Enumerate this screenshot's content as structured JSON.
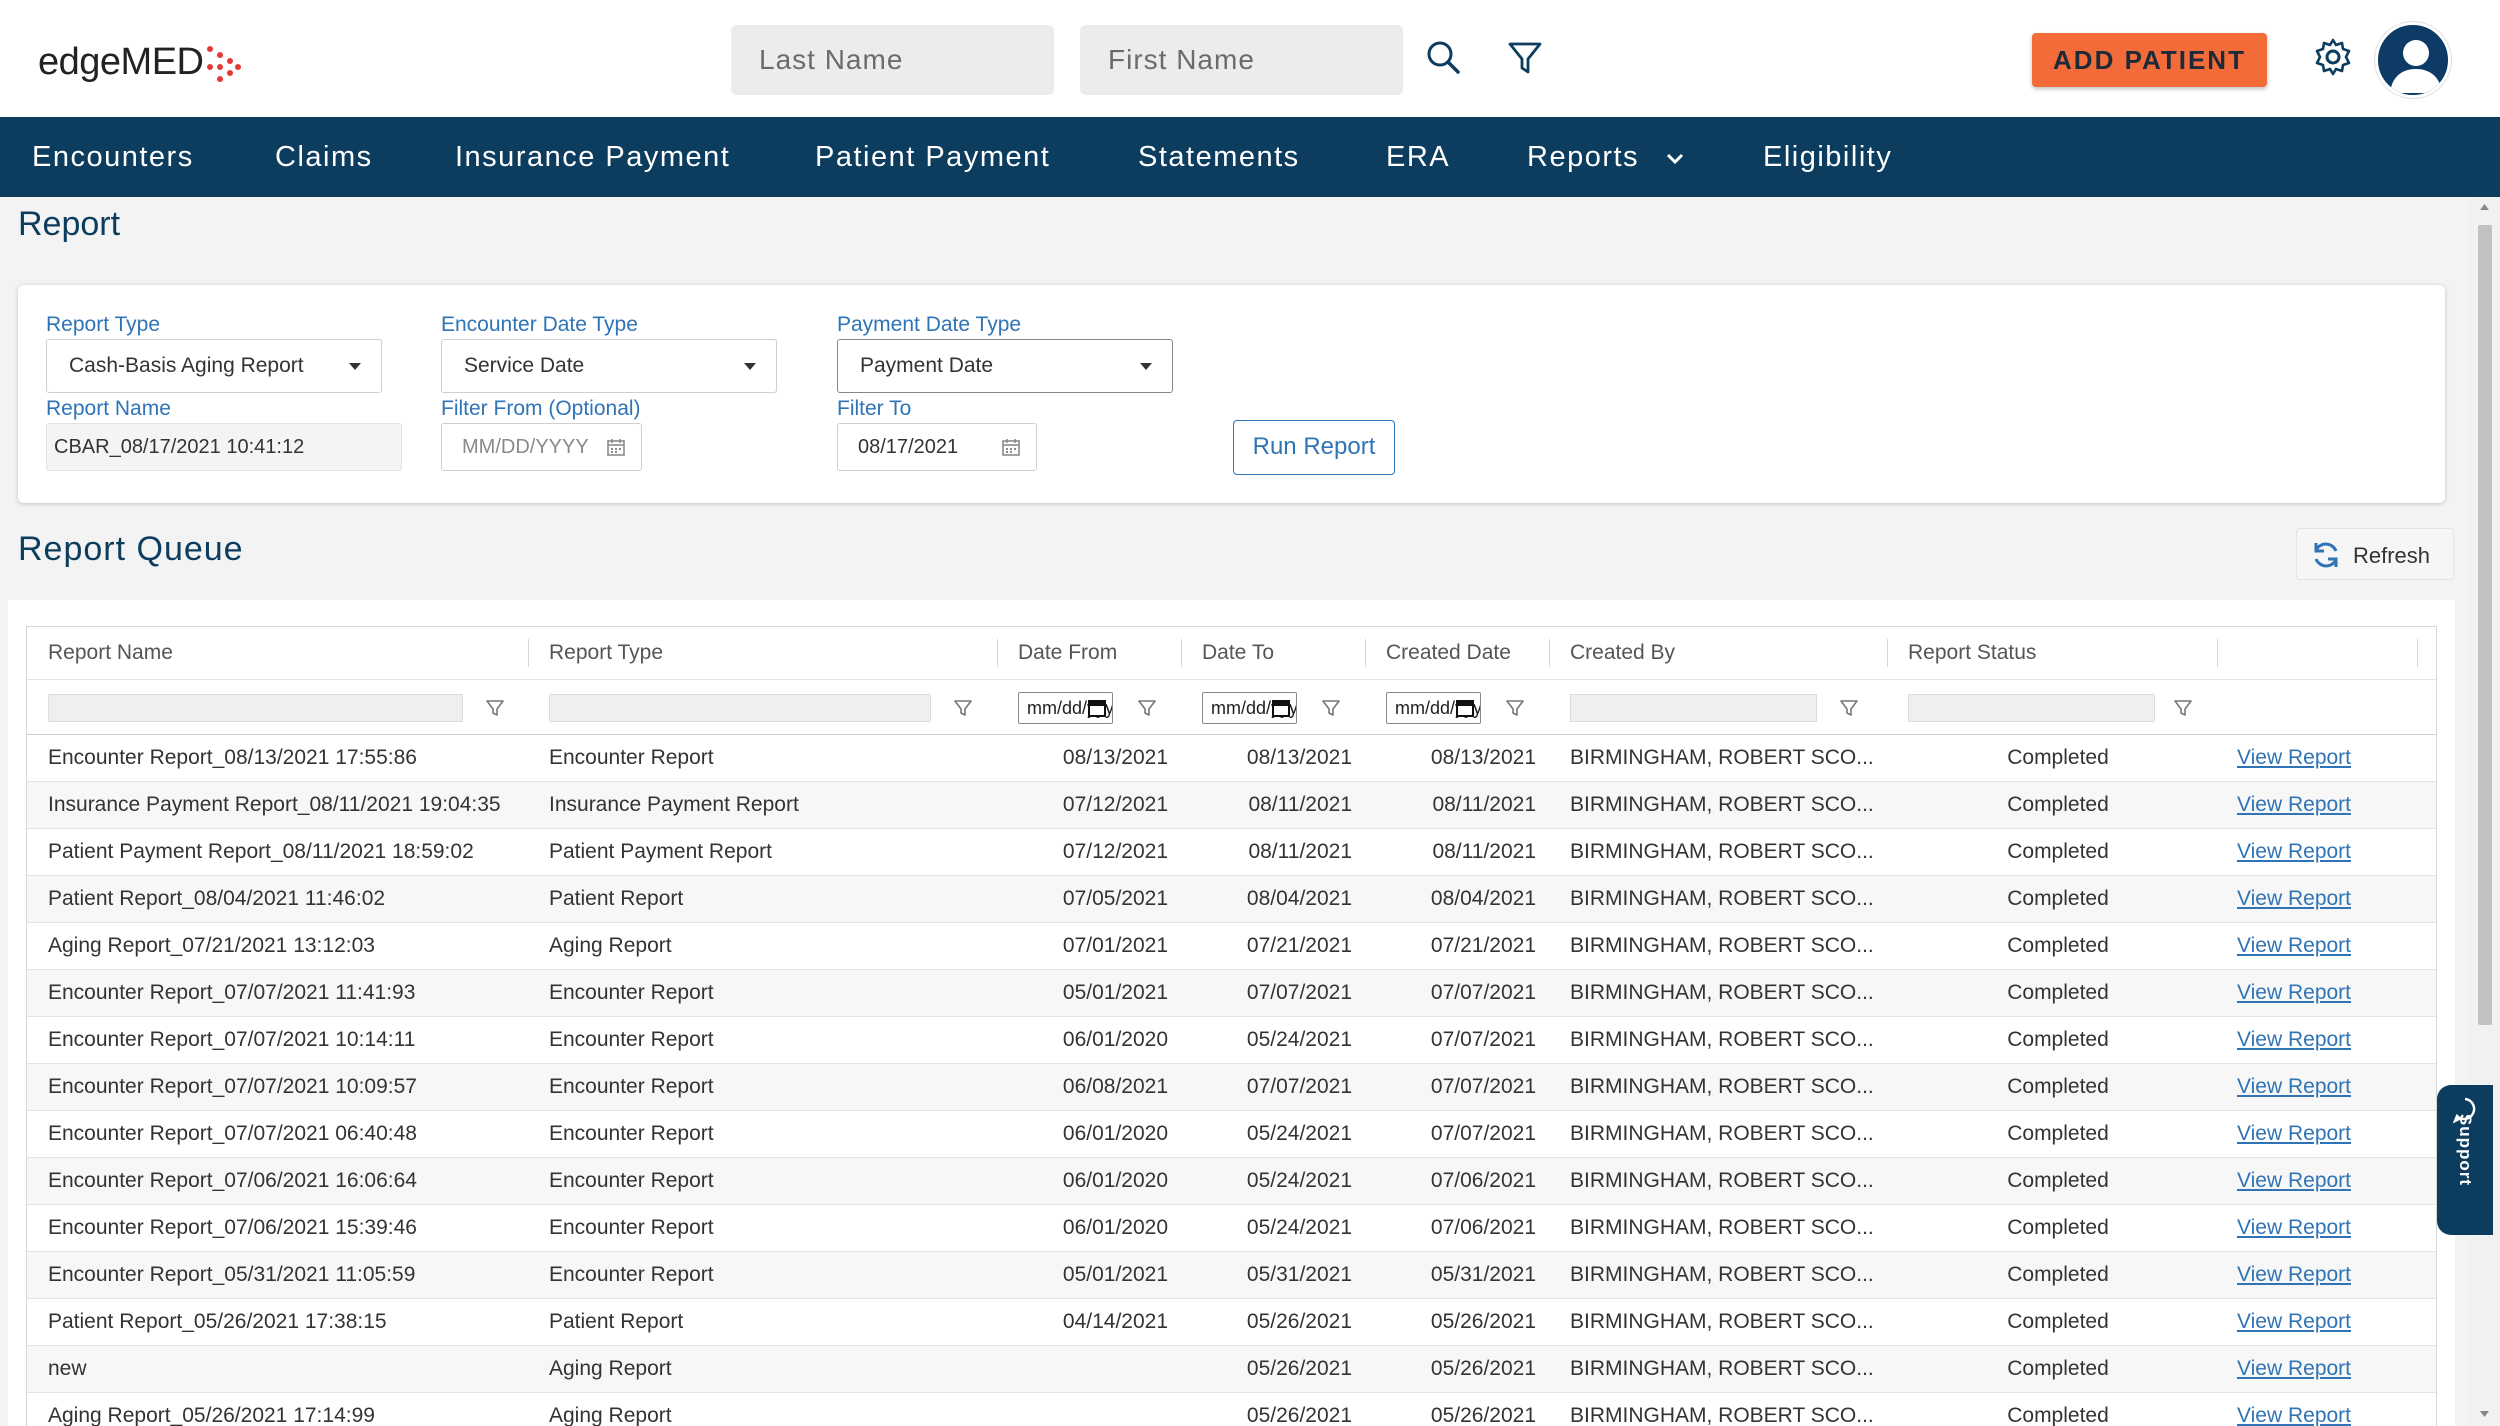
{
  "header": {
    "logo": "edgeMED",
    "last_name_placeholder": "Last Name",
    "first_name_placeholder": "First Name",
    "add_patient_label": "ADD PATIENT"
  },
  "nav": {
    "items": [
      "Encounters",
      "Claims",
      "Insurance Payment",
      "Patient Payment",
      "Statements",
      "ERA",
      "Reports",
      "Eligibility"
    ]
  },
  "page": {
    "title": "Report",
    "queue_title": "Report Queue",
    "refresh_label": "Refresh",
    "support_label": "Support"
  },
  "form": {
    "report_type_label": "Report Type",
    "report_type_value": "Cash-Basis Aging Report",
    "encounter_date_type_label": "Encounter Date Type",
    "encounter_date_type_value": "Service Date",
    "payment_date_type_label": "Payment Date Type",
    "payment_date_type_value": "Payment Date",
    "report_name_label": "Report Name",
    "report_name_value": "CBAR_08/17/2021 10:41:12",
    "filter_from_label": "Filter From (Optional)",
    "filter_from_placeholder": "MM/DD/YYYY",
    "filter_to_label": "Filter To",
    "filter_to_value": "08/17/2021",
    "run_report_label": "Run Report"
  },
  "grid": {
    "columns": [
      "Report Name",
      "Report Type",
      "Date From",
      "Date To",
      "Created Date",
      "Created By",
      "Report Status"
    ],
    "date_filter_placeholder": "mm/dd/yyyy",
    "rows": [
      {
        "name": "Encounter Report_08/13/2021 17:55:86",
        "type": "Encounter Report",
        "from": "08/13/2021",
        "to": "08/13/2021",
        "created": "08/13/2021",
        "by": "BIRMINGHAM, ROBERT SCO...",
        "status": "Completed",
        "action": "View Report"
      },
      {
        "name": "Insurance Payment Report_08/11/2021 19:04:35",
        "type": "Insurance Payment Report",
        "from": "07/12/2021",
        "to": "08/11/2021",
        "created": "08/11/2021",
        "by": "BIRMINGHAM, ROBERT SCO...",
        "status": "Completed",
        "action": "View Report"
      },
      {
        "name": "Patient Payment Report_08/11/2021 18:59:02",
        "type": "Patient Payment Report",
        "from": "07/12/2021",
        "to": "08/11/2021",
        "created": "08/11/2021",
        "by": "BIRMINGHAM, ROBERT SCO...",
        "status": "Completed",
        "action": "View Report"
      },
      {
        "name": "Patient Report_08/04/2021 11:46:02",
        "type": "Patient Report",
        "from": "07/05/2021",
        "to": "08/04/2021",
        "created": "08/04/2021",
        "by": "BIRMINGHAM, ROBERT SCO...",
        "status": "Completed",
        "action": "View Report"
      },
      {
        "name": "Aging Report_07/21/2021 13:12:03",
        "type": "Aging Report",
        "from": "07/01/2021",
        "to": "07/21/2021",
        "created": "07/21/2021",
        "by": "BIRMINGHAM, ROBERT SCO...",
        "status": "Completed",
        "action": "View Report"
      },
      {
        "name": "Encounter Report_07/07/2021 11:41:93",
        "type": "Encounter Report",
        "from": "05/01/2021",
        "to": "07/07/2021",
        "created": "07/07/2021",
        "by": "BIRMINGHAM, ROBERT SCO...",
        "status": "Completed",
        "action": "View Report"
      },
      {
        "name": "Encounter Report_07/07/2021 10:14:11",
        "type": "Encounter Report",
        "from": "06/01/2020",
        "to": "05/24/2021",
        "created": "07/07/2021",
        "by": "BIRMINGHAM, ROBERT SCO...",
        "status": "Completed",
        "action": "View Report"
      },
      {
        "name": "Encounter Report_07/07/2021 10:09:57",
        "type": "Encounter Report",
        "from": "06/08/2021",
        "to": "07/07/2021",
        "created": "07/07/2021",
        "by": "BIRMINGHAM, ROBERT SCO...",
        "status": "Completed",
        "action": "View Report"
      },
      {
        "name": "Encounter Report_07/07/2021 06:40:48",
        "type": "Encounter Report",
        "from": "06/01/2020",
        "to": "05/24/2021",
        "created": "07/07/2021",
        "by": "BIRMINGHAM, ROBERT SCO...",
        "status": "Completed",
        "action": "View Report"
      },
      {
        "name": "Encounter Report_07/06/2021 16:06:64",
        "type": "Encounter Report",
        "from": "06/01/2020",
        "to": "05/24/2021",
        "created": "07/06/2021",
        "by": "BIRMINGHAM, ROBERT SCO...",
        "status": "Completed",
        "action": "View Report"
      },
      {
        "name": "Encounter Report_07/06/2021 15:39:46",
        "type": "Encounter Report",
        "from": "06/01/2020",
        "to": "05/24/2021",
        "created": "07/06/2021",
        "by": "BIRMINGHAM, ROBERT SCO...",
        "status": "Completed",
        "action": "View Report"
      },
      {
        "name": "Encounter Report_05/31/2021 11:05:59",
        "type": "Encounter Report",
        "from": "05/01/2021",
        "to": "05/31/2021",
        "created": "05/31/2021",
        "by": "BIRMINGHAM, ROBERT SCO...",
        "status": "Completed",
        "action": "View Report"
      },
      {
        "name": "Patient Report_05/26/2021 17:38:15",
        "type": "Patient Report",
        "from": "04/14/2021",
        "to": "05/26/2021",
        "created": "05/26/2021",
        "by": "BIRMINGHAM, ROBERT SCO...",
        "status": "Completed",
        "action": "View Report"
      },
      {
        "name": "new",
        "type": "Aging Report",
        "from": "",
        "to": "05/26/2021",
        "created": "05/26/2021",
        "by": "BIRMINGHAM, ROBERT SCO...",
        "status": "Completed",
        "action": "View Report"
      },
      {
        "name": "Aging Report_05/26/2021 17:14:99",
        "type": "Aging Report",
        "from": "",
        "to": "05/26/2021",
        "created": "05/26/2021",
        "by": "BIRMINGHAM, ROBERT SCO...",
        "status": "Completed",
        "action": "View Report"
      }
    ]
  },
  "colors": {
    "nav_bg": "#0c3c5e",
    "accent_blue": "#2f74b6",
    "add_patient_bg": "#f26b38"
  }
}
